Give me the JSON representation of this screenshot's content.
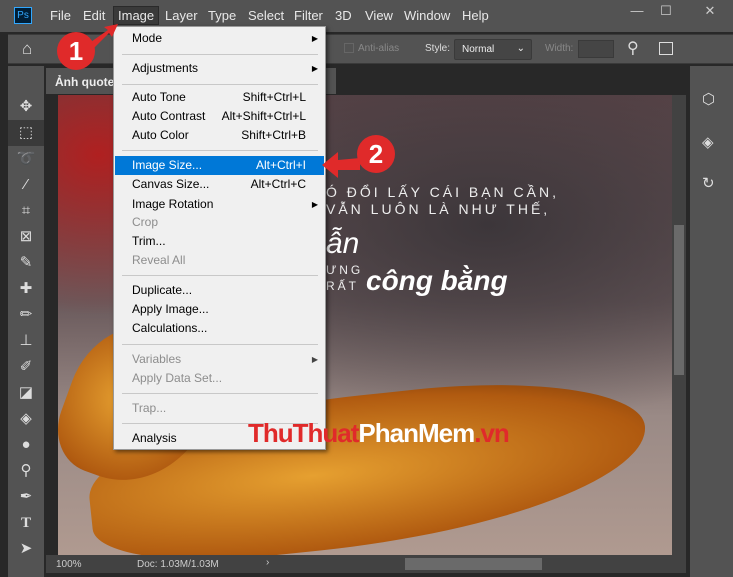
{
  "app": {
    "logo": "Ps"
  },
  "menubar": [
    "File",
    "Edit",
    "Image",
    "Layer",
    "Type",
    "Select",
    "Filter",
    "3D",
    "View",
    "Window",
    "Help"
  ],
  "window_controls": {
    "minimize": "—",
    "restore": "☐",
    "close": "✕"
  },
  "options": {
    "anti_alias": "Anti-alias",
    "style_label": "Style:",
    "style_value": "Normal",
    "width_label": "Width:"
  },
  "document": {
    "tab_title": "Ảnh quote",
    "quote_line1": "Ó ĐỔI LẤY CÁI BẠN CẦN,",
    "quote_line2": "VẪN LUÔN LÀ NHƯ THẾ,",
    "quote_script1": "ẫn",
    "quote_small1": "ƯNG",
    "quote_small2": "RẤT",
    "quote_script2": "công bằng"
  },
  "status": {
    "zoom": "100%",
    "doc": "Doc: 1.03M/1.03M"
  },
  "image_menu": {
    "mode": "Mode",
    "adjustments": "Adjustments",
    "auto_tone": "Auto Tone",
    "auto_tone_sc": "Shift+Ctrl+L",
    "auto_contrast": "Auto Contrast",
    "auto_contrast_sc": "Alt+Shift+Ctrl+L",
    "auto_color": "Auto Color",
    "auto_color_sc": "Shift+Ctrl+B",
    "image_size": "Image Size...",
    "image_size_sc": "Alt+Ctrl+I",
    "canvas_size": "Canvas Size...",
    "canvas_size_sc": "Alt+Ctrl+C",
    "image_rotation": "Image Rotation",
    "crop": "Crop",
    "trim": "Trim...",
    "reveal_all": "Reveal All",
    "duplicate": "Duplicate...",
    "apply_image": "Apply Image...",
    "calculations": "Calculations...",
    "variables": "Variables",
    "apply_data_set": "Apply Data Set...",
    "trap": "Trap...",
    "analysis": "Analysis"
  },
  "annotations": {
    "step1": "1",
    "step2": "2"
  },
  "watermark": {
    "part1": "ThuThuat",
    "part2": "PhanMem",
    "part3": ".vn"
  },
  "colors": {
    "accent": "#0078d7",
    "badge": "#e02a2a"
  }
}
